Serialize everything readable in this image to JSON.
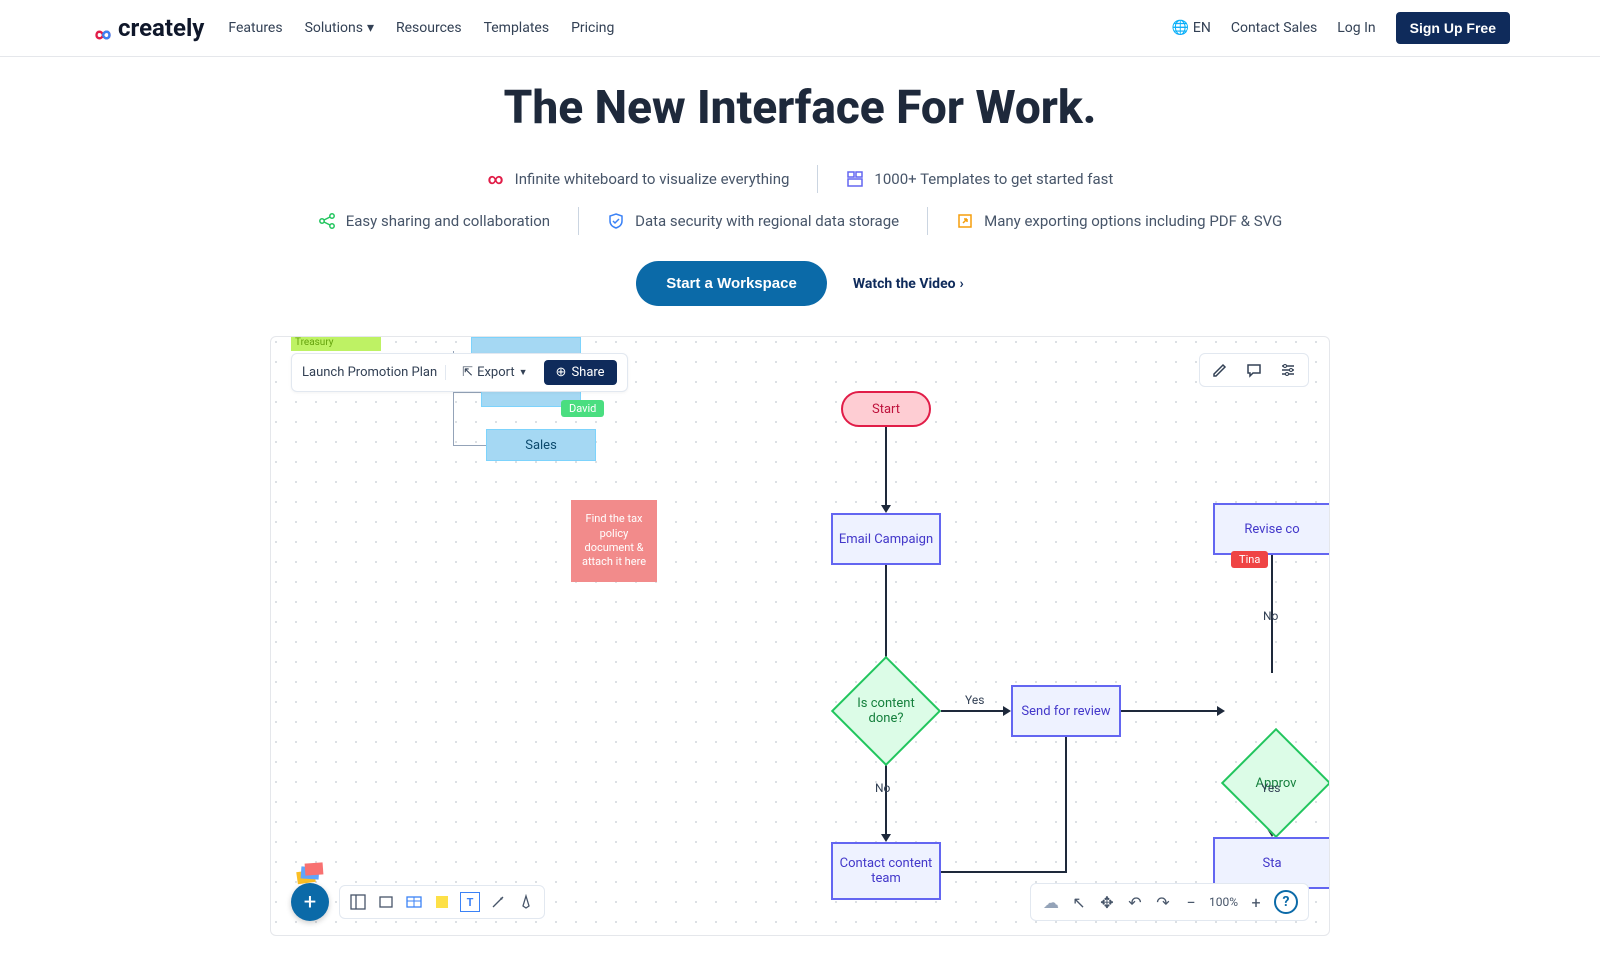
{
  "header": {
    "brand": "creately",
    "nav": [
      "Features",
      "Solutions",
      "Resources",
      "Templates",
      "Pricing"
    ],
    "lang": "EN",
    "contact": "Contact Sales",
    "login": "Log In",
    "signup": "Sign Up Free"
  },
  "hero": {
    "title": "The New Interface For Work.",
    "features": [
      {
        "icon": "infinity",
        "text": "Infinite whiteboard to visualize everything"
      },
      {
        "icon": "templates",
        "text": "1000+ Templates to get started fast"
      },
      {
        "icon": "share",
        "text": "Easy sharing and collaboration"
      },
      {
        "icon": "shield",
        "text": "Data security with regional data storage"
      },
      {
        "icon": "export",
        "text": "Many exporting options including PDF & SVG"
      }
    ],
    "cta_primary": "Start a Workspace",
    "cta_secondary": "Watch the Video"
  },
  "canvas": {
    "doc_title": "Launch Promotion Plan",
    "export_label": "Export",
    "share_label": "Share",
    "treasury": "Treasury",
    "blocks": {
      "sales": "Sales",
      "david": "David",
      "tina": "Tina"
    },
    "sticky_note": "Find the tax policy document & attach it here",
    "nodes": {
      "start": "Start",
      "email": "Email Campaign",
      "is_content": "Is content done?",
      "send_review": "Send for review",
      "approv": "Approv",
      "revise": "Revise co",
      "contact": "Contact content team",
      "sta": "Sta"
    },
    "edge_labels": {
      "yes1": "Yes",
      "no1": "No",
      "yes2": "Yes",
      "no2": "No"
    },
    "zoom": "100%",
    "fab": "+"
  }
}
